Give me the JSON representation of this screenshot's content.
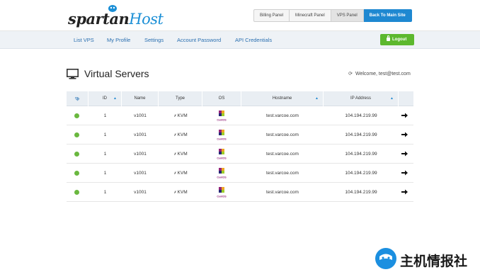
{
  "header": {
    "logo_text": "spartan",
    "logo_text_accent": "Host",
    "top_nav": [
      {
        "label": "Billing Panel",
        "active": false
      },
      {
        "label": "Minecraft Panel",
        "active": false
      },
      {
        "label": "VPS Panel",
        "active": true
      },
      {
        "label": "Back To Main Site",
        "primary": true
      }
    ]
  },
  "subnav": {
    "links": [
      "List VPS",
      "My Profile",
      "Settings",
      "Account Password",
      "API Credentials"
    ],
    "logout_label": "Logout"
  },
  "page": {
    "title": "Virtual Servers",
    "welcome": "Welcome, test@test.com",
    "title_icon": "monitor-icon",
    "refresh_icon": "refresh-icon"
  },
  "table": {
    "columns": [
      "",
      "ID",
      "Name",
      "Type",
      "OS",
      "Hostname",
      "IP Address",
      ""
    ],
    "rows": [
      {
        "status": "online",
        "id": "1",
        "name": "v1001",
        "type": "KVM",
        "os": "CentOS",
        "hostname": "test.varcoe.com",
        "ip": "104.194.219.99"
      },
      {
        "status": "online",
        "id": "1",
        "name": "v1001",
        "type": "KVM",
        "os": "CentOS",
        "hostname": "test.varcoe.com",
        "ip": "104.194.219.99"
      },
      {
        "status": "online",
        "id": "1",
        "name": "v1001",
        "type": "KVM",
        "os": "CentOS",
        "hostname": "test.varcoe.com",
        "ip": "104.194.219.99"
      },
      {
        "status": "online",
        "id": "1",
        "name": "v1001",
        "type": "KVM",
        "os": "CentOS",
        "hostname": "test.varcoe.com",
        "ip": "104.194.219.99"
      },
      {
        "status": "online",
        "id": "1",
        "name": "v1001",
        "type": "KVM",
        "os": "CentOS",
        "hostname": "test.varcoe.com",
        "ip": "104.194.219.99"
      }
    ],
    "status_color": "#6ab83f"
  },
  "colors": {
    "accent": "#1e88d1",
    "logout_green": "#5cb82e"
  },
  "watermark": {
    "text": "主机情报社"
  }
}
